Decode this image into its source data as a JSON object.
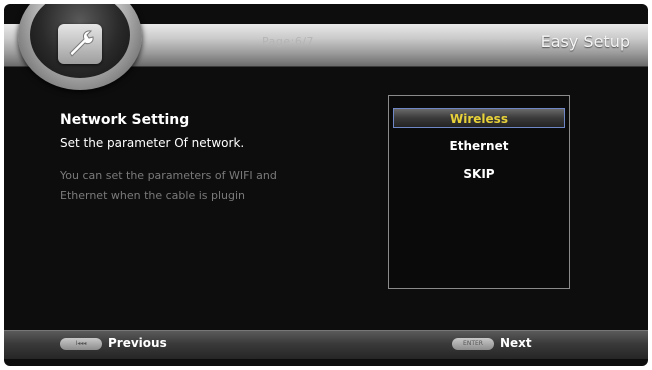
{
  "header": {
    "page_indicator": "Page:6/7",
    "title": "Easy Setup",
    "emblem_icon": "wrench-settings-icon"
  },
  "description": {
    "title": "Network Setting",
    "subtitle": "Set the parameter Of network.",
    "body": "You can set the parameters of WIFI and Ethernet when the cable is plugin"
  },
  "options": {
    "items": [
      {
        "label": "Wireless",
        "selected": true
      },
      {
        "label": "Ethernet",
        "selected": false
      },
      {
        "label": "SKIP",
        "selected": false
      }
    ]
  },
  "footer": {
    "previous_key": "I◂◂◂",
    "previous_label": "Previous",
    "next_key": "ENTER",
    "next_label": "Next"
  },
  "colors": {
    "selected_text": "#e8d23a",
    "selection_border": "#6f86c7",
    "background": "#0d0d0d"
  }
}
